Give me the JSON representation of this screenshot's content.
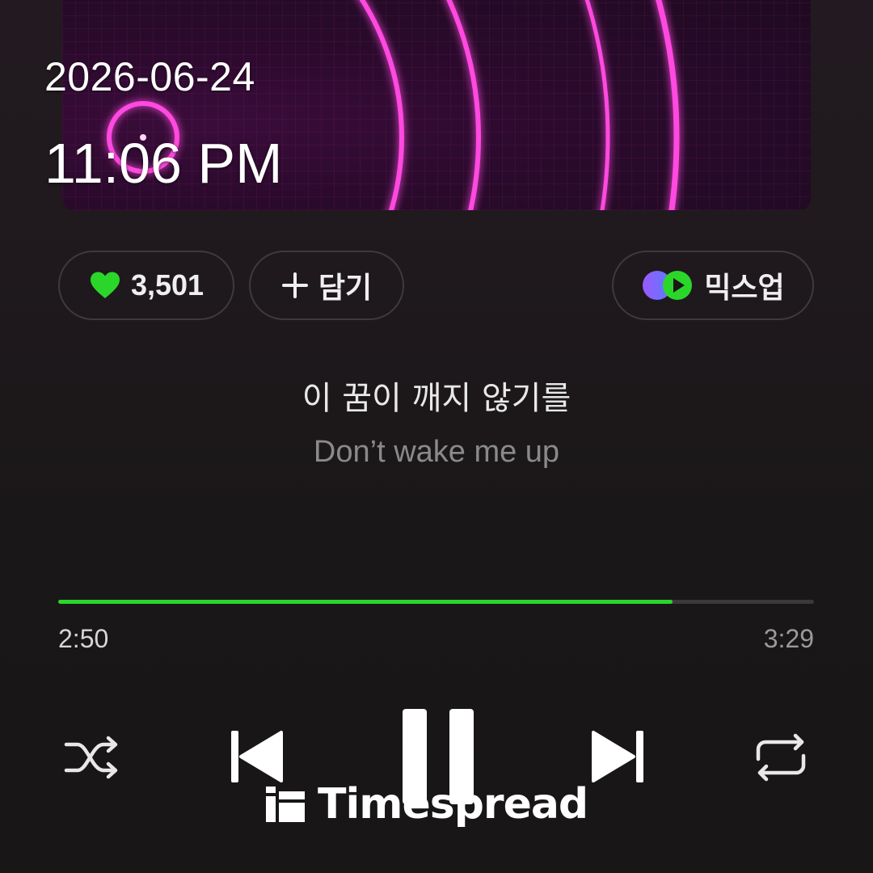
{
  "overlay": {
    "date": "2026-06-24",
    "time": "11:06 PM"
  },
  "actions": {
    "like_count": "3,501",
    "add_label": "담기",
    "mixup_label": "믹스업"
  },
  "lyrics": {
    "korean": "이 꿈이 깨지 않기를",
    "english": "Don’t wake me up"
  },
  "player": {
    "elapsed": "2:50",
    "duration": "3:29",
    "progress_fraction": 0.813
  },
  "watermark": {
    "text": "Timespread"
  },
  "colors": {
    "accent": "#2bd62b",
    "neon": "#ff3ad6",
    "background": "#1a1718"
  },
  "icons": [
    "heart-icon",
    "plus-icon",
    "mixup-icon",
    "shuffle-icon",
    "previous-icon",
    "pause-icon",
    "next-icon",
    "repeat-icon"
  ]
}
